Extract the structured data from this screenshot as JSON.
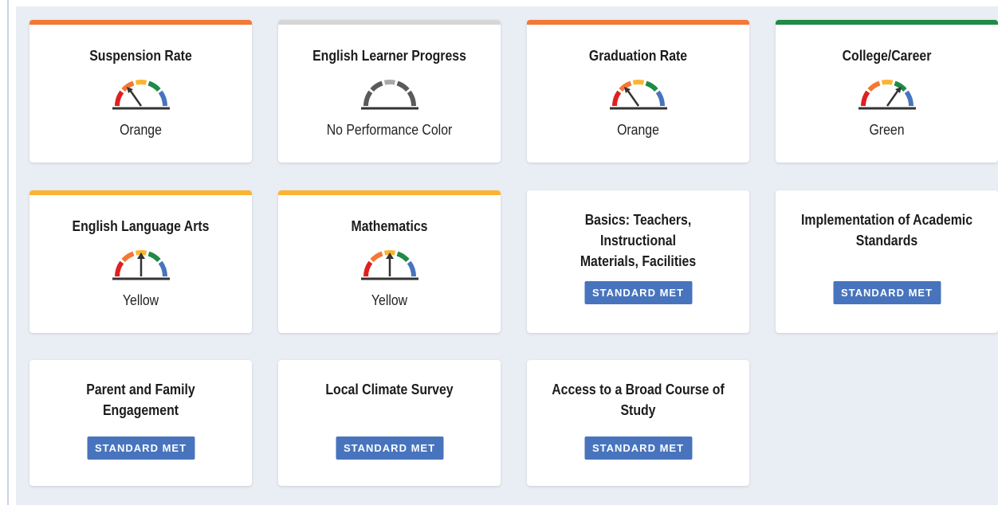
{
  "cards": [
    {
      "title": "Suspension Rate",
      "status": "Orange",
      "bar_color": "#f47735",
      "needle": "orange"
    },
    {
      "title": "English Learner Progress",
      "status": "No Performance Color",
      "bar_color": "#d6d6d6",
      "needle": "none"
    },
    {
      "title": "Graduation Rate",
      "status": "Orange",
      "bar_color": "#f47735",
      "needle": "orange"
    },
    {
      "title": "College/Career",
      "status": "Green",
      "bar_color": "#1f8b45",
      "needle": "green"
    },
    {
      "title": "English Language Arts",
      "status": "Yellow",
      "bar_color": "#fbb431",
      "needle": "yellow"
    },
    {
      "title": "Mathematics",
      "status": "Yellow",
      "bar_color": "#fbb431",
      "needle": "yellow"
    },
    {
      "title_line1": "Basics: Teachers, Instructional",
      "title_line2": "Materials, Facilities",
      "badge": "STANDARD MET"
    },
    {
      "title_line1": "Implementation of Academic",
      "title_line2": "Standards",
      "badge": "STANDARD MET"
    },
    {
      "title_line1": "Parent and Family",
      "title_line2": "Engagement",
      "badge": "STANDARD MET"
    },
    {
      "title": "Local Climate Survey",
      "badge": "STANDARD MET"
    },
    {
      "title_line1": "Access to a Broad Course of",
      "title_line2": "Study",
      "badge": "STANDARD MET"
    }
  ],
  "gauge_colors": {
    "red": "#e02020",
    "orange": "#f47735",
    "yellow": "#fbb431",
    "green": "#1f8b45",
    "blue": "#4874be",
    "grey_dark": "#5a5a5a",
    "grey_light": "#a9a9a9",
    "needle": "#333333"
  }
}
